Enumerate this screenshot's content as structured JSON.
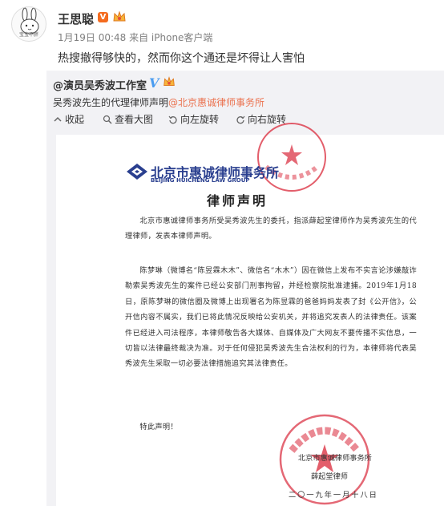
{
  "post": {
    "author": "王思聪",
    "vip_label": "V",
    "avatar_caption": "宝宝不胖",
    "meta": "1月19日 00:48 来自 iPhone客户端",
    "text": "热搜撤得够快的，然而你这个通还是坏得让人害怕"
  },
  "repost": {
    "author": "@演员吴秀波工作室",
    "verified_label": "V",
    "text": "吴秀波先生的代理律师声明",
    "mention": "@北京惠诚律师事务所"
  },
  "toolbar": {
    "collapse": "收起",
    "view_large": "查看大图",
    "rotate_left": "向左旋转",
    "rotate_right": "向右旋转"
  },
  "document": {
    "firm_name_cn": "北京市惠诚律师事务所",
    "firm_name_en": "BEIJING HUICHENG LAW GROUP",
    "title": "律师声明",
    "paragraph1": "北京市惠诚律师事务所受吴秀波先生的委托，指派薛起堂律师作为吴秀波先生的代理律师，发表本律师声明。",
    "paragraph2": "陈梦琳（微博名“陈昱霖木木”、微信名“木木”）因在微信上发布不实言论涉嫌敲诈勒索吴秀波先生的案件已经公安部门刑事拘留，并经检察院批准逮捕。2019年1月18日，原陈梦琳的微信圈及微博上出现署名为陈昱霖的爸爸妈妈发表了封《公开信》，公开信内容不属实，我们已将此情况反映给公安机关，并将追究发表人的法律责任。该案件已经进入司法程序，本律师敬告各大媒体、自媒体及广大网友不要传播不实信息，一切皆以法律最终裁决为准。对于任何侵犯吴秀波先生合法权利的行为，本律师将代表吴秀波先生采取一切必要法律措施追究其法律责任。",
    "paragraph3": "特此声明！",
    "signature_firm": "北京市惠诚律师事务所",
    "signature_lawyer": "薛起堂律师",
    "signature_date": "二〇一九年一月十八日",
    "seal_text": "北京市惠诚律师事务所"
  },
  "colors": {
    "link": "#eb7350",
    "repost_bg": "#f2f2f5",
    "seal_red": "#d9283a",
    "firm_blue": "#2a3f8f",
    "vip_orange": "#f46b1f",
    "verified_blue": "#4a9cf0"
  },
  "icons": [
    "collapse-icon",
    "magnify-icon",
    "rotate-left-icon",
    "rotate-right-icon",
    "crown-icon",
    "firm-logo-icon",
    "seal-star-icon"
  ]
}
